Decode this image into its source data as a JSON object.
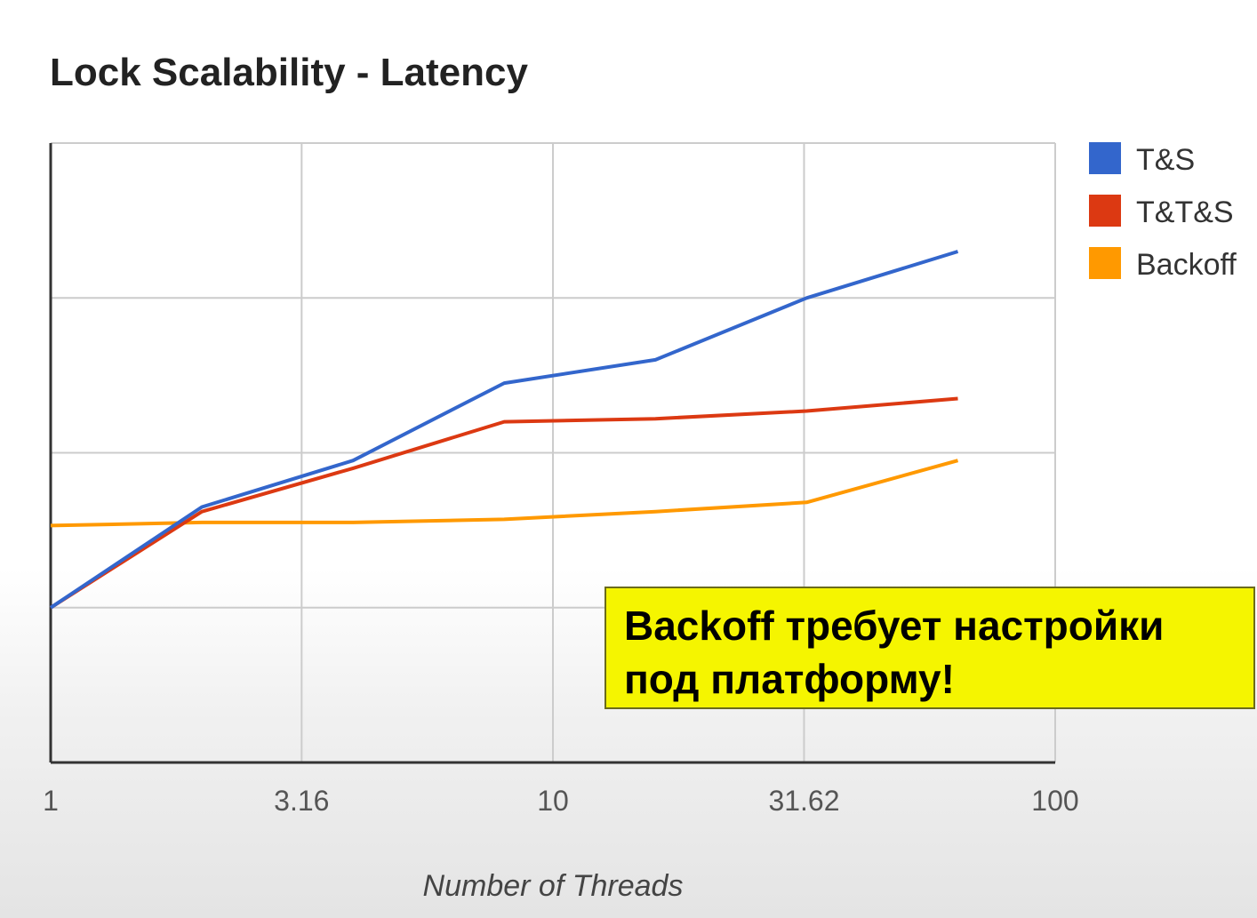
{
  "chart_data": {
    "type": "line",
    "title": "Lock Scalability - Latency",
    "xlabel": "Number of Threads",
    "ylabel": "",
    "x_scale": "log",
    "xlim": [
      1,
      100
    ],
    "ylim": [
      0,
      4
    ],
    "x_ticks": [
      "1",
      "3.16",
      "10",
      "31.62",
      "100"
    ],
    "grid": true,
    "legend_position": "right",
    "x": [
      1,
      2,
      4,
      8,
      16,
      32,
      64
    ],
    "series": [
      {
        "name": "T&S",
        "color": "#3366cc",
        "values": [
          1.0,
          1.65,
          1.95,
          2.45,
          2.6,
          3.0,
          3.3
        ]
      },
      {
        "name": "T&T&S",
        "color": "#dc3912",
        "values": [
          1.0,
          1.62,
          1.9,
          2.2,
          2.22,
          2.27,
          2.35
        ]
      },
      {
        "name": "Backoff",
        "color": "#ff9900",
        "values": [
          1.53,
          1.55,
          1.55,
          1.57,
          1.62,
          1.68,
          1.95
        ]
      }
    ]
  },
  "annotation": {
    "line1": "Backoff требует настройки",
    "line2": "под платформу!",
    "background": "#f5f500"
  }
}
